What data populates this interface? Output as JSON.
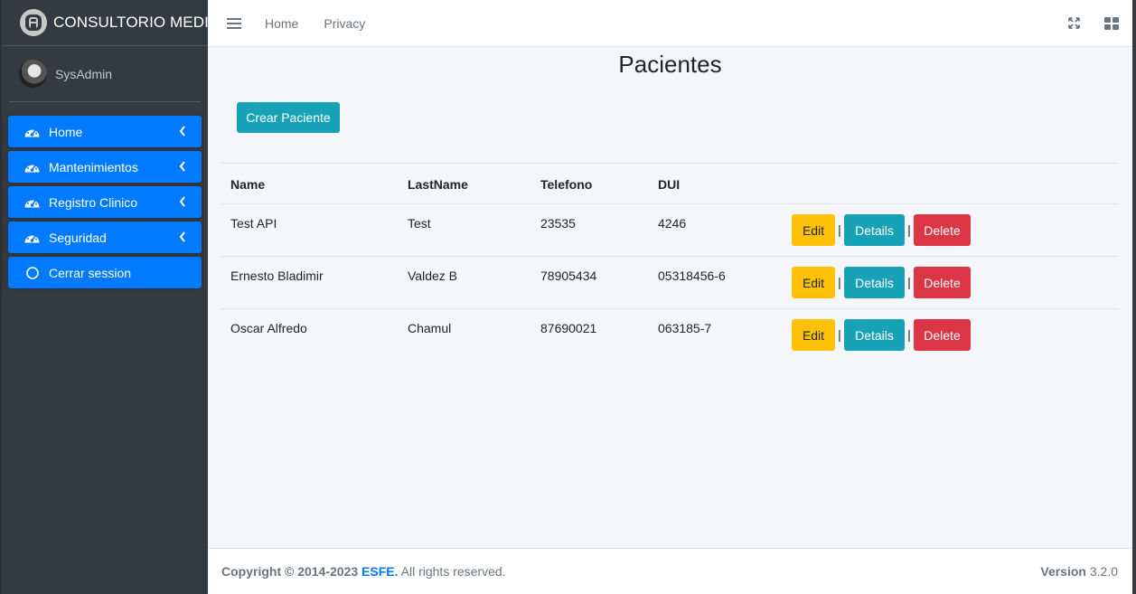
{
  "brand": {
    "name": "CONSULTORIO MEDICO",
    "logo_icon": "brand-logo-icon"
  },
  "user": {
    "name": "SysAdmin"
  },
  "sidebar": {
    "items": [
      {
        "label": "Home",
        "icon": "tachometer-icon",
        "has_chevron": true
      },
      {
        "label": "Mantenimientos",
        "icon": "tachometer-icon",
        "has_chevron": true
      },
      {
        "label": "Registro Clinico",
        "icon": "tachometer-icon",
        "has_chevron": true
      },
      {
        "label": "Seguridad",
        "icon": "tachometer-icon",
        "has_chevron": true
      },
      {
        "label": "Cerrar session",
        "icon": "circle-icon",
        "has_chevron": false
      }
    ]
  },
  "topbar": {
    "links": [
      "Home",
      "Privacy"
    ],
    "right_icons": [
      "expand-icon",
      "grid-icon"
    ]
  },
  "main": {
    "title": "Pacientes",
    "create_button": "Crear Paciente",
    "table": {
      "columns": [
        "Name",
        "LastName",
        "Telefono",
        "DUI",
        ""
      ],
      "rows": [
        {
          "name": "Test API",
          "lastname": "Test",
          "telefono": "23535",
          "dui": "4246"
        },
        {
          "name": "Ernesto Bladimir",
          "lastname": "Valdez B",
          "telefono": "78905434",
          "dui": "05318456-6"
        },
        {
          "name": "Oscar Alfredo",
          "lastname": "Chamul",
          "telefono": "87690021",
          "dui": "063185-7"
        }
      ],
      "actions": {
        "edit": "Edit",
        "details": "Details",
        "delete": "Delete",
        "separator": "|"
      }
    }
  },
  "footer": {
    "copyright_prefix": "Copyright © 2014-2023",
    "company": "ESFE.",
    "rights": "All rights reserved.",
    "version_label": "Version",
    "version_value": "3.2.0"
  },
  "colors": {
    "sidebar_bg": "#343a40",
    "nav_active": "#007bff",
    "info": "#17a2b8",
    "warning": "#ffc107",
    "danger": "#dc3545",
    "content_bg": "#f4f6f9"
  }
}
